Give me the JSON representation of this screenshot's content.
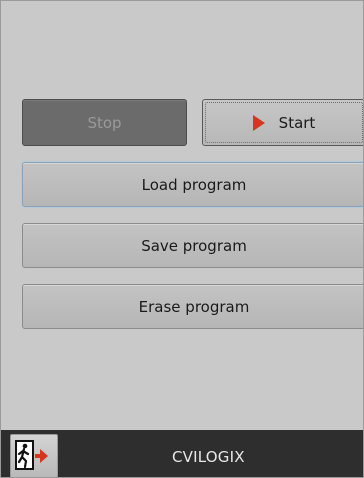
{
  "controls": {
    "stop_label": "Stop",
    "start_label": "Start"
  },
  "program": {
    "load_label": "Load program",
    "save_label": "Save program",
    "erase_label": "Erase program"
  },
  "footer": {
    "title": "CVILOGIX"
  },
  "icons": {
    "start": "play-icon",
    "exit": "exit-door-icon"
  },
  "colors": {
    "panel_bg": "#c9c9c9",
    "stop_disabled_bg": "#6b6b6b",
    "play_icon": "#d9341f",
    "footer_bg": "#2e2e2e"
  }
}
